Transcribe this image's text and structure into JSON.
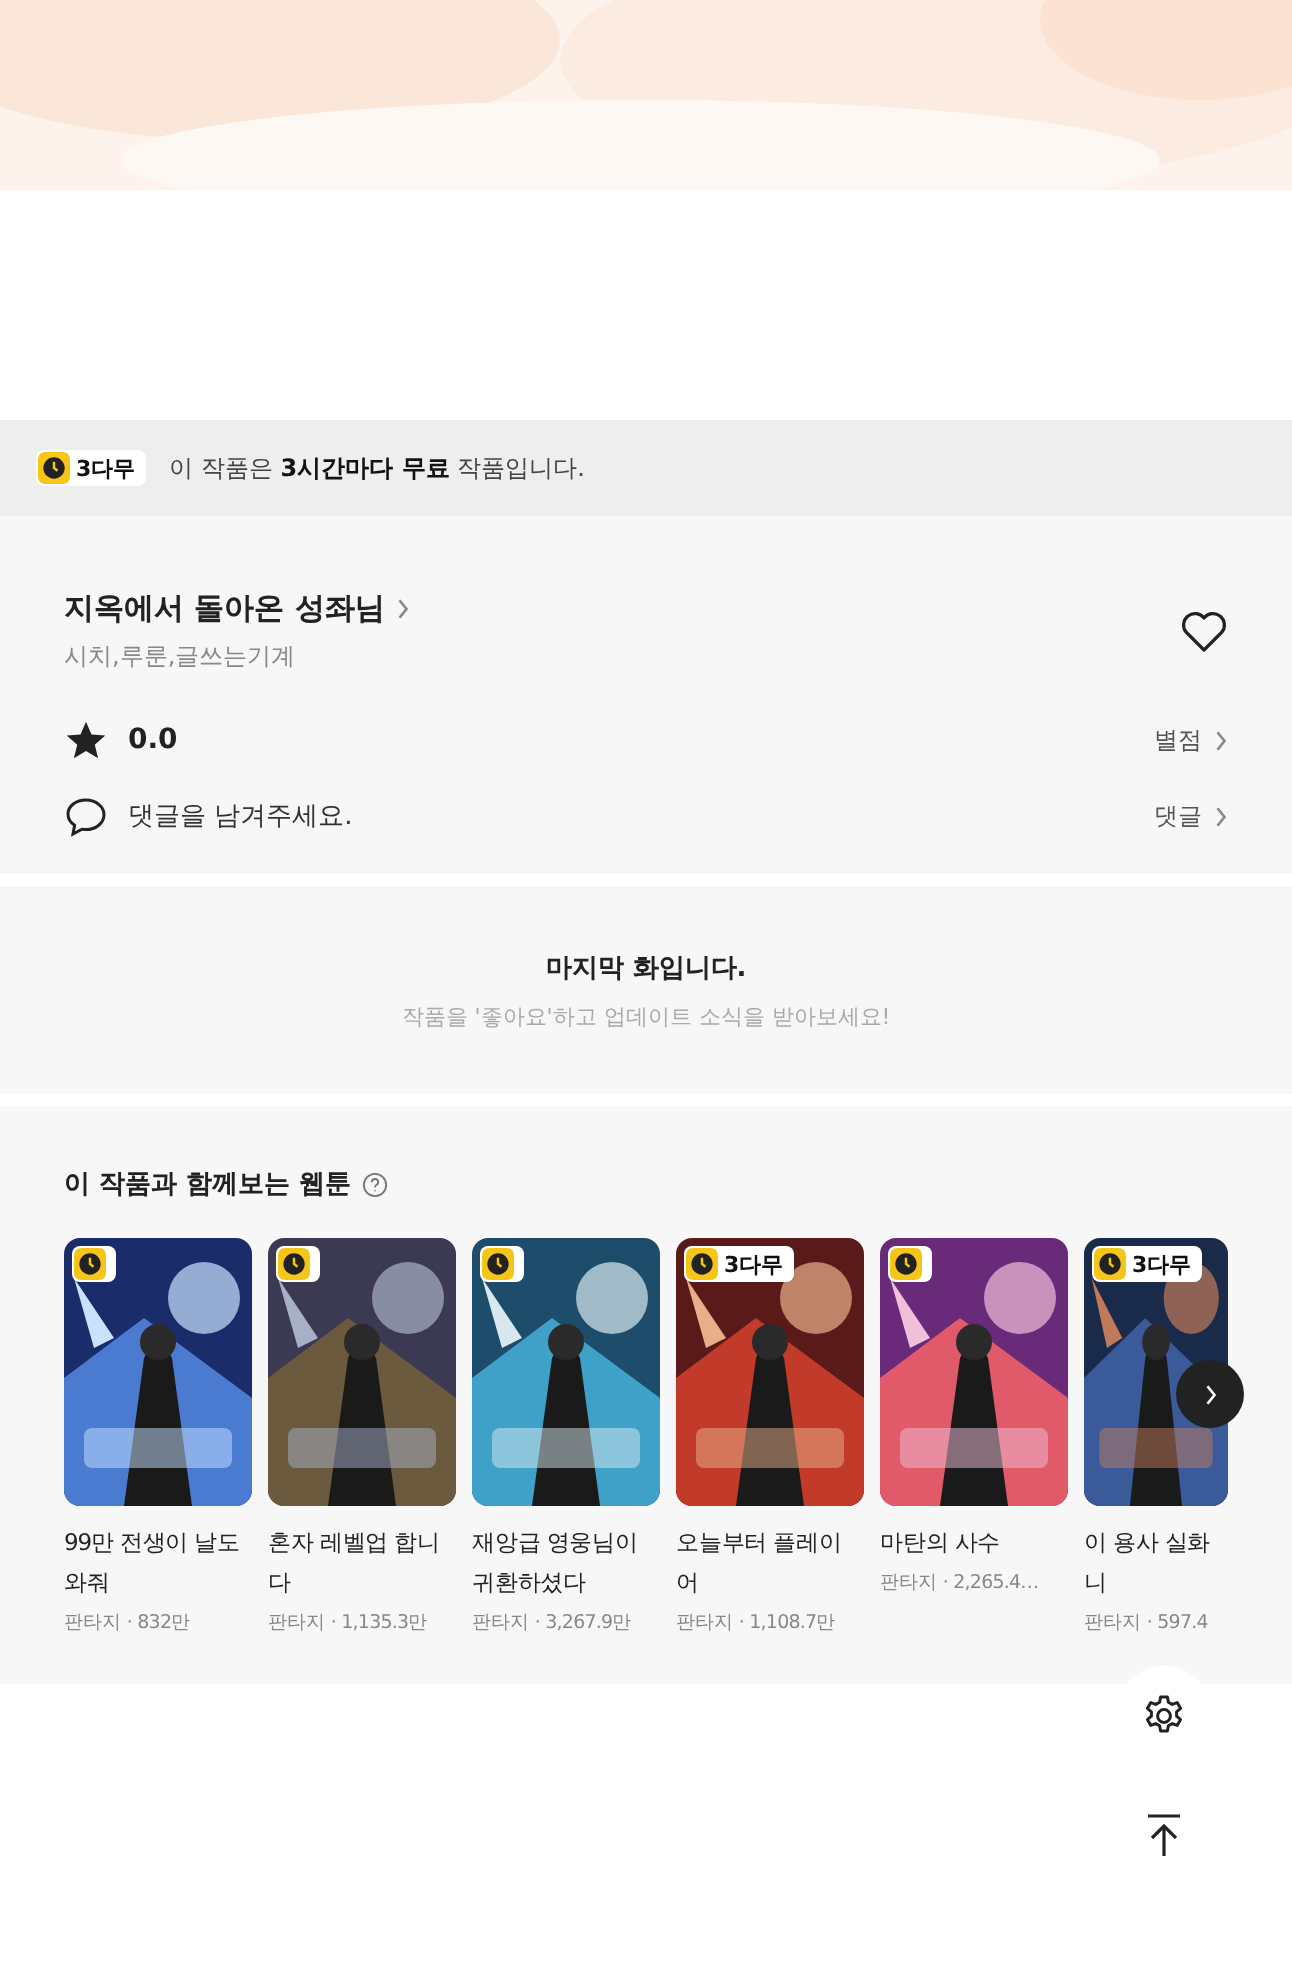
{
  "notice": {
    "badge": "3다무",
    "text": "이 작품은 **3시간마다 무료** 작품입니다."
  },
  "series": {
    "title": "지옥에서 돌아온 성좌님",
    "authors": "시치,루룬,글쓰는기계",
    "liked": false,
    "rating": "0.0",
    "rating_link": "별점",
    "comment_prompt": "댓글을 남겨주세요.",
    "comment_link": "댓글"
  },
  "last_episode": {
    "title": "마지막 화입니다.",
    "subtitle": "작품을 '좋아요'하고 업데이트 소식을 받아보세요!"
  },
  "recommend": {
    "heading": "이 작품과 함께보는 웹툰",
    "items": [
      {
        "title": "99만 전생이 날도와줘",
        "meta": "판타지 · 832만"
      },
      {
        "title": "혼자 레벨업 합니다",
        "meta": "판타지 · 1,135.3만"
      },
      {
        "title": "재앙급 영웅님이 귀환하셨다",
        "meta": "판타지 · 3,267.9만"
      },
      {
        "title": "오늘부터 플레이어",
        "meta": "판타지 · 1,108.7만",
        "badge": "3다무"
      },
      {
        "title": "마탄의 사수",
        "meta": "판타지 · 2,265.4…"
      },
      {
        "title": "이 용사 실화니",
        "meta": "판타지 · 597.4",
        "badge": "3다무"
      }
    ]
  }
}
